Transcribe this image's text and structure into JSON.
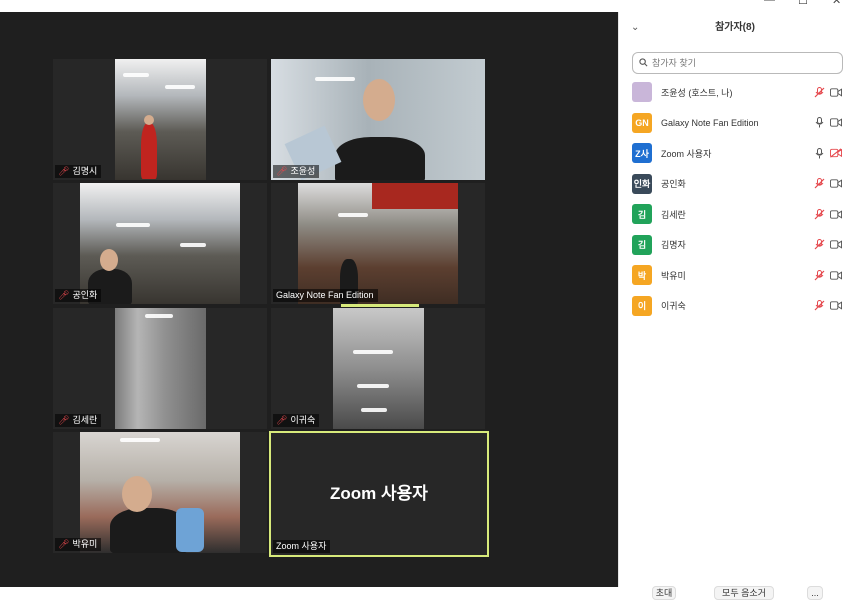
{
  "window": {
    "minimize": "—",
    "maximize": "☐",
    "close": "✕"
  },
  "tiles": [
    {
      "name": "김명시",
      "muted": true,
      "scene": "gym"
    },
    {
      "name": "조윤성",
      "muted": true,
      "scene": "room"
    },
    {
      "name": "공인화",
      "muted": true,
      "scene": "gym"
    },
    {
      "name": "Galaxy Note Fan Edition",
      "muted": false,
      "scene": "store"
    },
    {
      "name": "김세란",
      "muted": true,
      "scene": "pillar"
    },
    {
      "name": "이귀숙",
      "muted": true,
      "scene": "ceiling"
    },
    {
      "name": "박유미",
      "muted": true,
      "scene": "selfie"
    },
    {
      "name": "Zoom 사용자",
      "muted": false,
      "scene": "none",
      "big_label": "Zoom 사용자"
    }
  ],
  "panel": {
    "title": "참가자(8)",
    "search_placeholder": "참가자 찾기",
    "participants": [
      {
        "avatar_text": "",
        "avatar_color": "#c9b6d9",
        "name": "조윤성 (호스트, 나)",
        "mic": "muted",
        "video": "on"
      },
      {
        "avatar_text": "GN",
        "avatar_color": "#f5a623",
        "name": "Galaxy Note Fan Edition",
        "mic": "on",
        "video": "on"
      },
      {
        "avatar_text": "Z사",
        "avatar_color": "#1f6fd1",
        "name": "Zoom 사용자",
        "mic": "on",
        "video": "off"
      },
      {
        "avatar_text": "인화",
        "avatar_color": "#3a4a5a",
        "name": "공인화",
        "mic": "muted",
        "video": "on"
      },
      {
        "avatar_text": "김",
        "avatar_color": "#21a35a",
        "name": "김세란",
        "mic": "muted",
        "video": "on"
      },
      {
        "avatar_text": "김",
        "avatar_color": "#21a35a",
        "name": "김명자",
        "mic": "muted",
        "video": "on"
      },
      {
        "avatar_text": "박",
        "avatar_color": "#f5a623",
        "name": "박유미",
        "mic": "muted",
        "video": "on"
      },
      {
        "avatar_text": "이",
        "avatar_color": "#f5a623",
        "name": "이귀숙",
        "mic": "muted",
        "video": "on"
      }
    ],
    "footer": {
      "invite": "초대",
      "mute_all": "모두 음소거",
      "more": "..."
    }
  },
  "colors": {
    "active_speaker": "#d7ea7b",
    "muted_red": "#e5484d",
    "background": "#1f1f1f"
  }
}
